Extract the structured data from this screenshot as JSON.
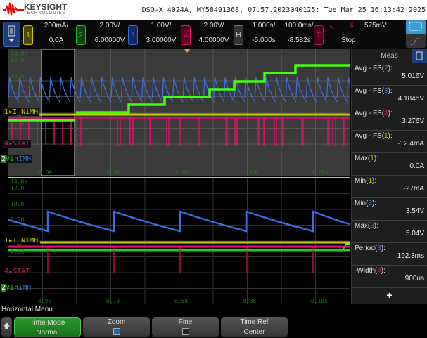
{
  "header": {
    "brand": "KEYSIGHT",
    "brand_sub": "TECHNOLOGIES",
    "identity": "DSO-X 4024A, MY58491368, 07.57.2023040125: Tue Mar 25 16:13:42 2025"
  },
  "toolbar": {
    "channels": [
      {
        "num": "1",
        "scale": "200mA/",
        "offset": "0.0A",
        "color": "#c8c800"
      },
      {
        "num": "2",
        "scale": "2.00V/",
        "offset": "6.00000V",
        "color": "#22c022"
      },
      {
        "num": "3",
        "scale": "1.00V/",
        "offset": "3.00000V",
        "color": "#3a6ee0"
      },
      {
        "num": "4",
        "scale": "2.00V/",
        "offset": "4.00000V",
        "color": "#e0106a"
      }
    ],
    "horizontal": {
      "label": "H",
      "main_scale": "1.000s/",
      "main_delay": "-5.000s",
      "zoom_scale": "100.0ms/",
      "zoom_delay": "-8.582s"
    },
    "trigger": {
      "label": "T",
      "source": "4",
      "level": "575mV",
      "state": "Stop",
      "edge_icon": "falling-edge-icon"
    }
  },
  "overview": {
    "x_labels": [
      "-9.00",
      "-7.00",
      "-5.00",
      "-3.00",
      "-1.00s"
    ],
    "y_labels": [
      "14.0V",
      "12.0",
      "10.0",
      "8.00",
      "4.00"
    ]
  },
  "zoomed": {
    "x_labels": [
      "-8.98",
      "-8.78",
      "-8.58",
      "-8.38",
      "-8.18s"
    ],
    "y_labels": [
      "14.0V",
      "12.0",
      "10.0",
      "8.00",
      "4.00"
    ]
  },
  "trace_labels": {
    "ch1": "I_NiMH",
    "ch4": "STAT",
    "ch2a": "Vin",
    "ch2b": "IMH"
  },
  "meas": {
    "title": "Meas",
    "items": [
      {
        "label": "Avg - FS(",
        "ch": "2",
        "value": "5.016V",
        "color": "#22c022"
      },
      {
        "label": "Avg - FS(",
        "ch": "3",
        "value": "4.1845V",
        "color": "#3a6ee0"
      },
      {
        "label": "Avg - FS(",
        "ch": "4",
        "value": "3.276V",
        "color": "#e0106a"
      },
      {
        "label": "Avg - FS(",
        "ch": "1",
        "value": "-12.4mA",
        "color": "#c8c800"
      },
      {
        "label": "Max(",
        "ch": "1",
        "value": "0.0A",
        "color": "#c8c800"
      },
      {
        "label": "Min(",
        "ch": "1",
        "value": "-27mA",
        "color": "#c8c800"
      },
      {
        "label": "Min(",
        "ch": "3",
        "value": "3.54V",
        "color": "#3a6ee0"
      },
      {
        "label": "Max(",
        "ch": "3",
        "value": "5.04V",
        "color": "#3a6ee0"
      },
      {
        "label": "Period(",
        "ch": "3",
        "value": "192.3ms",
        "color": "#3a6ee0"
      },
      {
        "label": "-Width(",
        "ch": "4",
        "value": "900us",
        "color": "#e0106a"
      }
    ],
    "add": "+"
  },
  "menu": {
    "title": "Horizontal Menu",
    "keys": [
      {
        "label": "Time Mode",
        "value": "Normal"
      },
      {
        "label": "Zoom",
        "checked": true
      },
      {
        "label": "Fine",
        "checked": false
      },
      {
        "label": "Time Ref",
        "value": "Center"
      }
    ]
  }
}
